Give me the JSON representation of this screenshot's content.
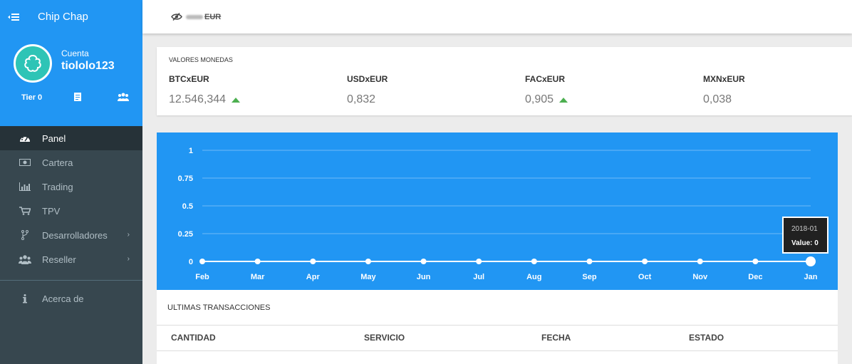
{
  "app": {
    "title": "Chip Chap"
  },
  "profile": {
    "account_label": "Cuenta",
    "username": "tiololo123",
    "tier": "Tier 0"
  },
  "nav": {
    "items": [
      {
        "label": "Panel",
        "icon": "dashboard-icon",
        "active": true
      },
      {
        "label": "Cartera",
        "icon": "money-icon"
      },
      {
        "label": "Trading",
        "icon": "bar-chart-icon"
      },
      {
        "label": "TPV",
        "icon": "cart-icon"
      },
      {
        "label": "Desarrolladores",
        "icon": "code-fork-icon",
        "has_submenu": true
      },
      {
        "label": "Reseller",
        "icon": "users-icon",
        "has_submenu": true
      }
    ],
    "footer_items": [
      {
        "label": "Acerca de",
        "icon": "info-icon"
      }
    ]
  },
  "topbar": {
    "balance_currency": "EUR"
  },
  "valores": {
    "title": "VALORES MONEDAS",
    "rates": [
      {
        "name": "BTCxEUR",
        "value": "12.546,344",
        "trend": "up"
      },
      {
        "name": "USDxEUR",
        "value": "0,832",
        "trend": "none"
      },
      {
        "name": "FACxEUR",
        "value": "0,905",
        "trend": "up"
      },
      {
        "name": "MXNxEUR",
        "value": "0,038",
        "trend": "none"
      }
    ]
  },
  "chart_data": {
    "type": "line",
    "categories": [
      "Feb",
      "Mar",
      "Apr",
      "May",
      "Jun",
      "Jul",
      "Aug",
      "Sep",
      "Oct",
      "Nov",
      "Dec",
      "Jan"
    ],
    "values": [
      0,
      0,
      0,
      0,
      0,
      0,
      0,
      0,
      0,
      0,
      0,
      0
    ],
    "y_ticks": [
      "1",
      "0.75",
      "0.5",
      "0.25",
      "0"
    ],
    "ylim": [
      0,
      1
    ],
    "grid": true,
    "tooltip": {
      "date": "2018-01",
      "value_text": "Value: 0"
    }
  },
  "transactions": {
    "title": "ULTIMAS TRANSACCIONES",
    "columns": [
      "CANTIDAD",
      "SERVICIO",
      "FECHA",
      "ESTADO"
    ]
  },
  "colors": {
    "primary": "#2196f3",
    "sidebar": "#37474f",
    "sidebar_active": "#263238",
    "trend_up": "#4caf50"
  }
}
